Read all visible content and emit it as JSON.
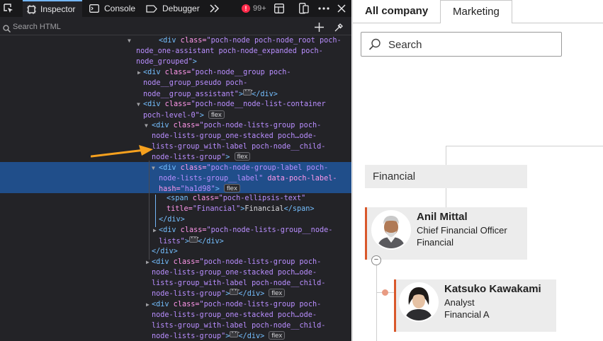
{
  "devtools": {
    "tools": {
      "inspector": "Inspector",
      "console": "Console",
      "debugger": "Debugger",
      "error_count": "99+"
    },
    "search_placeholder": "Search HTML",
    "lines": [
      {
        "pre": "<",
        "tag": "div",
        "a1": " class=",
        "v1": "\"poch-node poch-node_root poch-",
        "rest": ""
      },
      {
        "v1": "node_one-assistant poch-node_expanded poch-"
      },
      {
        "v1": "node_grouped\"",
        "post": ">"
      },
      {
        "tag": "div",
        "a1": " class=",
        "v1": "\"poch-node__group poch-"
      },
      {
        "v1": "node__group_pseudo poch-"
      },
      {
        "v1": "node__group_assistant\"",
        "close": "</div>"
      },
      {
        "tag": "div",
        "a1": " class=",
        "v1": "\"poch-node__node-list-container"
      },
      {
        "v1": "poch-level-0\"",
        "post": ">",
        "badge": "flex"
      },
      {
        "tag": "div",
        "a1": " class=",
        "v1": "\"poch-node-lists-group poch-"
      },
      {
        "v1": "node-lists-group_one-stacked poch…ode-"
      },
      {
        "v1": "lists-group_with-label poch-node__child-"
      },
      {
        "v1": "node-lists-group\"",
        "post": ">",
        "badge": "flex"
      },
      {
        "tag": "div",
        "a1": " class=",
        "v1": "\"poch-node-group-label poch-"
      },
      {
        "v1": "node-lists-group__label\"",
        "a2": " data-poch-label-"
      },
      {
        "a2": "hash=",
        "v2": "\"ha1d98\"",
        "post": ">",
        "badge": "flex"
      },
      {
        "tag": "span",
        "a1": " class=",
        "v1": "\"poch-ellipsis-text\""
      },
      {
        "a2": "title=",
        "v2": "\"Financial\"",
        "post": ">",
        "text": "Financial",
        "ctag": "span"
      },
      {
        "ctag": "div"
      },
      {
        "tag": "div",
        "a1": " class=",
        "v1": "\"poch-node-lists-group__node-"
      },
      {
        "v1": "lists\"",
        "close": "</div>"
      },
      {
        "ctag": "div"
      },
      {
        "tag": "div",
        "a1": " class=",
        "v1": "\"poch-node-lists-group poch-"
      },
      {
        "v1": "node-lists-group_one-stacked poch…ode-"
      },
      {
        "v1": "lists-group_with-label poch-node__child-"
      },
      {
        "v1": "node-lists-group\"",
        "close": "</div>",
        "badge": "flex"
      },
      {
        "tag": "div",
        "a1": " class=",
        "v1": "\"poch-node-lists-group poch-"
      },
      {
        "v1": "node-lists-group_one-stacked poch…ode-"
      },
      {
        "v1": "lists-group_with-label poch-node__child-"
      },
      {
        "v1": "node-lists-group\"",
        "close": "</div>",
        "badge": "flex"
      }
    ]
  },
  "page": {
    "tabs": {
      "active": "All company",
      "second": "Marketing"
    },
    "search_placeholder": "Search",
    "group_label": "Financial",
    "cards": [
      {
        "name": "Anil Mittal",
        "title": "Chief Financial Officer",
        "dept": "Financial"
      },
      {
        "name": "Katsuko Kawakami",
        "title": "Analyst",
        "dept": "Financial A"
      }
    ],
    "collapse_symbol": "−"
  },
  "colors": {
    "accent": "#d9582b",
    "selection": "#204e8a",
    "arrow": "#f5a01e"
  }
}
